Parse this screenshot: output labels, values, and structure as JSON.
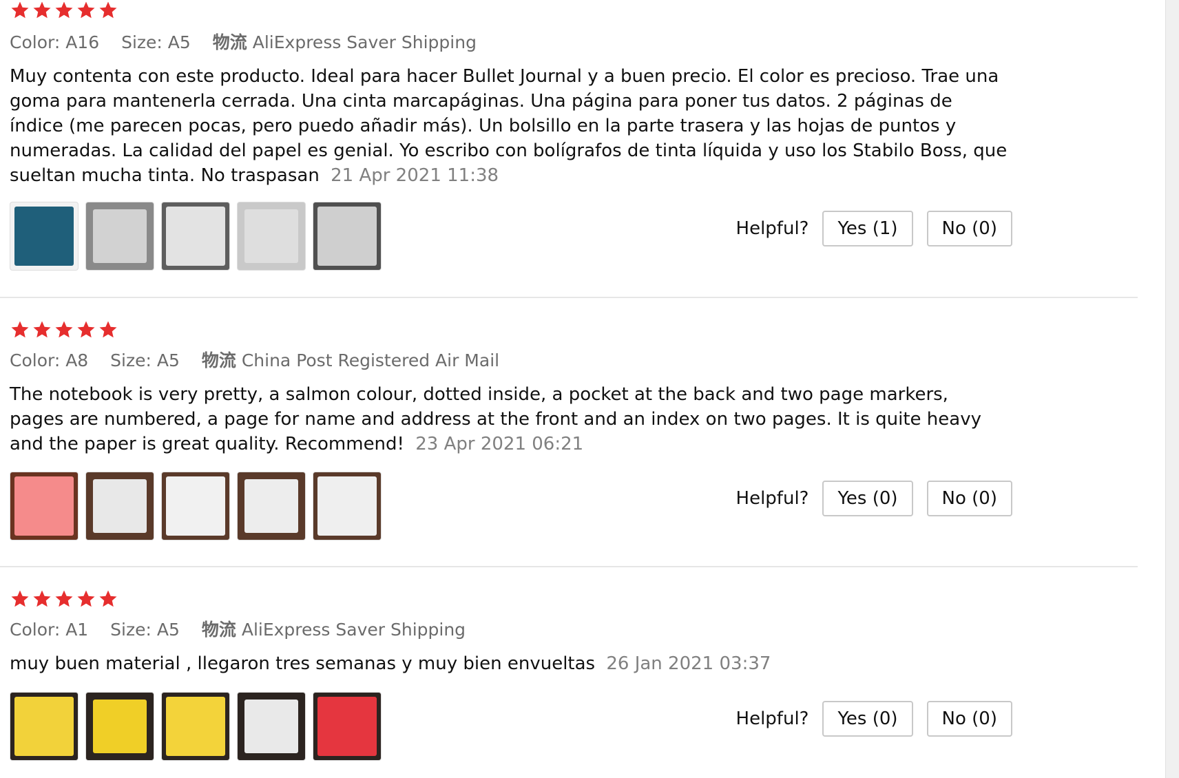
{
  "colors": {
    "star": "#e62e2e",
    "meta_text": "#6b6b6b",
    "date_text": "#808080",
    "divider": "#e6e6e6"
  },
  "icons": {
    "star": "star-icon"
  },
  "reviews": [
    {
      "rating": 5,
      "meta": {
        "color_label": "Color: A16",
        "size_label": "Size: A5",
        "logistics_mark": "物流",
        "shipping": "AliExpress Saver Shipping"
      },
      "text": "Muy contenta con este producto. Ideal para hacer Bullet Journal y a buen precio. El color es precioso. Trae una goma para mantenerla cerrada. Una cinta marcapáginas. Una página para poner tus datos. 2 páginas de índice (me parecen pocas, pero puedo añadir más). Un bolsillo en la parte trasera y las hojas de puntos y numeradas. La calidad del papel es genial. Yo escribo con bolígrafos de tinta líquida y uso los Stabilo Boss, que sueltan mucha tinta. No traspasan",
      "date": "21 Apr 2021 11:38",
      "helpful": {
        "label": "Helpful?",
        "yes": "Yes (1)",
        "no": "No (0)"
      },
      "thumb_colors": [
        "#1f5f7a",
        "#d2d2d2",
        "#e3e3e3",
        "#dedede",
        "#cfcfcf"
      ],
      "thumb_borders": [
        "#f2f2f2",
        "#8a8a8a",
        "#5e5e5e",
        "#c9c9c9",
        "#505050"
      ]
    },
    {
      "rating": 5,
      "meta": {
        "color_label": "Color: A8",
        "size_label": "Size: A5",
        "logistics_mark": "物流",
        "shipping": "China Post Registered Air Mail"
      },
      "text": "The notebook is very pretty, a salmon colour, dotted inside, a pocket at the back and two page markers, pages are numbered, a page for name and address at the front and an index on two pages. It is quite heavy and the paper is great quality. Recommend!",
      "date": "23 Apr 2021 06:21",
      "helpful": {
        "label": "Helpful?",
        "yes": "Yes (0)",
        "no": "No (0)"
      },
      "thumb_colors": [
        "#f58b8b",
        "#e8e8e8",
        "#f1f1f1",
        "#ededed",
        "#efefef"
      ],
      "thumb_borders": [
        "#6a3320",
        "#5a3a2a",
        "#5a3a2a",
        "#5a3a2a",
        "#5a3a2a"
      ]
    },
    {
      "rating": 5,
      "meta": {
        "color_label": "Color: A1",
        "size_label": "Size: A5",
        "logistics_mark": "物流",
        "shipping": "AliExpress Saver Shipping"
      },
      "text": "muy buen material , llegaron tres semanas y muy bien envueltas",
      "date": "26 Jan 2021 03:37",
      "helpful": {
        "label": "Helpful?",
        "yes": "Yes (0)",
        "no": "No (0)"
      },
      "thumb_colors": [
        "#f2d23a",
        "#f0cf27",
        "#f3d33a",
        "#e9e9e9",
        "#e5363f"
      ],
      "thumb_borders": [
        "#2c2420",
        "#2c2420",
        "#2c2420",
        "#2c2420",
        "#2c2420"
      ]
    }
  ]
}
